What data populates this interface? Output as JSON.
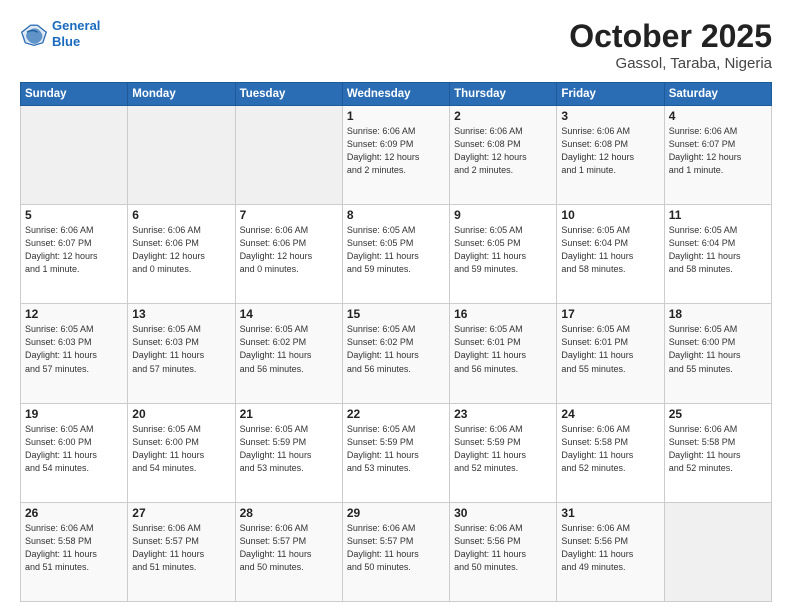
{
  "header": {
    "logo_line1": "General",
    "logo_line2": "Blue",
    "title": "October 2025",
    "subtitle": "Gassol, Taraba, Nigeria"
  },
  "weekdays": [
    "Sunday",
    "Monday",
    "Tuesday",
    "Wednesday",
    "Thursday",
    "Friday",
    "Saturday"
  ],
  "weeks": [
    [
      {
        "day": "",
        "info": ""
      },
      {
        "day": "",
        "info": ""
      },
      {
        "day": "",
        "info": ""
      },
      {
        "day": "1",
        "info": "Sunrise: 6:06 AM\nSunset: 6:09 PM\nDaylight: 12 hours\nand 2 minutes."
      },
      {
        "day": "2",
        "info": "Sunrise: 6:06 AM\nSunset: 6:08 PM\nDaylight: 12 hours\nand 2 minutes."
      },
      {
        "day": "3",
        "info": "Sunrise: 6:06 AM\nSunset: 6:08 PM\nDaylight: 12 hours\nand 1 minute."
      },
      {
        "day": "4",
        "info": "Sunrise: 6:06 AM\nSunset: 6:07 PM\nDaylight: 12 hours\nand 1 minute."
      }
    ],
    [
      {
        "day": "5",
        "info": "Sunrise: 6:06 AM\nSunset: 6:07 PM\nDaylight: 12 hours\nand 1 minute."
      },
      {
        "day": "6",
        "info": "Sunrise: 6:06 AM\nSunset: 6:06 PM\nDaylight: 12 hours\nand 0 minutes."
      },
      {
        "day": "7",
        "info": "Sunrise: 6:06 AM\nSunset: 6:06 PM\nDaylight: 12 hours\nand 0 minutes."
      },
      {
        "day": "8",
        "info": "Sunrise: 6:05 AM\nSunset: 6:05 PM\nDaylight: 11 hours\nand 59 minutes."
      },
      {
        "day": "9",
        "info": "Sunrise: 6:05 AM\nSunset: 6:05 PM\nDaylight: 11 hours\nand 59 minutes."
      },
      {
        "day": "10",
        "info": "Sunrise: 6:05 AM\nSunset: 6:04 PM\nDaylight: 11 hours\nand 58 minutes."
      },
      {
        "day": "11",
        "info": "Sunrise: 6:05 AM\nSunset: 6:04 PM\nDaylight: 11 hours\nand 58 minutes."
      }
    ],
    [
      {
        "day": "12",
        "info": "Sunrise: 6:05 AM\nSunset: 6:03 PM\nDaylight: 11 hours\nand 57 minutes."
      },
      {
        "day": "13",
        "info": "Sunrise: 6:05 AM\nSunset: 6:03 PM\nDaylight: 11 hours\nand 57 minutes."
      },
      {
        "day": "14",
        "info": "Sunrise: 6:05 AM\nSunset: 6:02 PM\nDaylight: 11 hours\nand 56 minutes."
      },
      {
        "day": "15",
        "info": "Sunrise: 6:05 AM\nSunset: 6:02 PM\nDaylight: 11 hours\nand 56 minutes."
      },
      {
        "day": "16",
        "info": "Sunrise: 6:05 AM\nSunset: 6:01 PM\nDaylight: 11 hours\nand 56 minutes."
      },
      {
        "day": "17",
        "info": "Sunrise: 6:05 AM\nSunset: 6:01 PM\nDaylight: 11 hours\nand 55 minutes."
      },
      {
        "day": "18",
        "info": "Sunrise: 6:05 AM\nSunset: 6:00 PM\nDaylight: 11 hours\nand 55 minutes."
      }
    ],
    [
      {
        "day": "19",
        "info": "Sunrise: 6:05 AM\nSunset: 6:00 PM\nDaylight: 11 hours\nand 54 minutes."
      },
      {
        "day": "20",
        "info": "Sunrise: 6:05 AM\nSunset: 6:00 PM\nDaylight: 11 hours\nand 54 minutes."
      },
      {
        "day": "21",
        "info": "Sunrise: 6:05 AM\nSunset: 5:59 PM\nDaylight: 11 hours\nand 53 minutes."
      },
      {
        "day": "22",
        "info": "Sunrise: 6:05 AM\nSunset: 5:59 PM\nDaylight: 11 hours\nand 53 minutes."
      },
      {
        "day": "23",
        "info": "Sunrise: 6:06 AM\nSunset: 5:59 PM\nDaylight: 11 hours\nand 52 minutes."
      },
      {
        "day": "24",
        "info": "Sunrise: 6:06 AM\nSunset: 5:58 PM\nDaylight: 11 hours\nand 52 minutes."
      },
      {
        "day": "25",
        "info": "Sunrise: 6:06 AM\nSunset: 5:58 PM\nDaylight: 11 hours\nand 52 minutes."
      }
    ],
    [
      {
        "day": "26",
        "info": "Sunrise: 6:06 AM\nSunset: 5:58 PM\nDaylight: 11 hours\nand 51 minutes."
      },
      {
        "day": "27",
        "info": "Sunrise: 6:06 AM\nSunset: 5:57 PM\nDaylight: 11 hours\nand 51 minutes."
      },
      {
        "day": "28",
        "info": "Sunrise: 6:06 AM\nSunset: 5:57 PM\nDaylight: 11 hours\nand 50 minutes."
      },
      {
        "day": "29",
        "info": "Sunrise: 6:06 AM\nSunset: 5:57 PM\nDaylight: 11 hours\nand 50 minutes."
      },
      {
        "day": "30",
        "info": "Sunrise: 6:06 AM\nSunset: 5:56 PM\nDaylight: 11 hours\nand 50 minutes."
      },
      {
        "day": "31",
        "info": "Sunrise: 6:06 AM\nSunset: 5:56 PM\nDaylight: 11 hours\nand 49 minutes."
      },
      {
        "day": "",
        "info": ""
      }
    ]
  ]
}
